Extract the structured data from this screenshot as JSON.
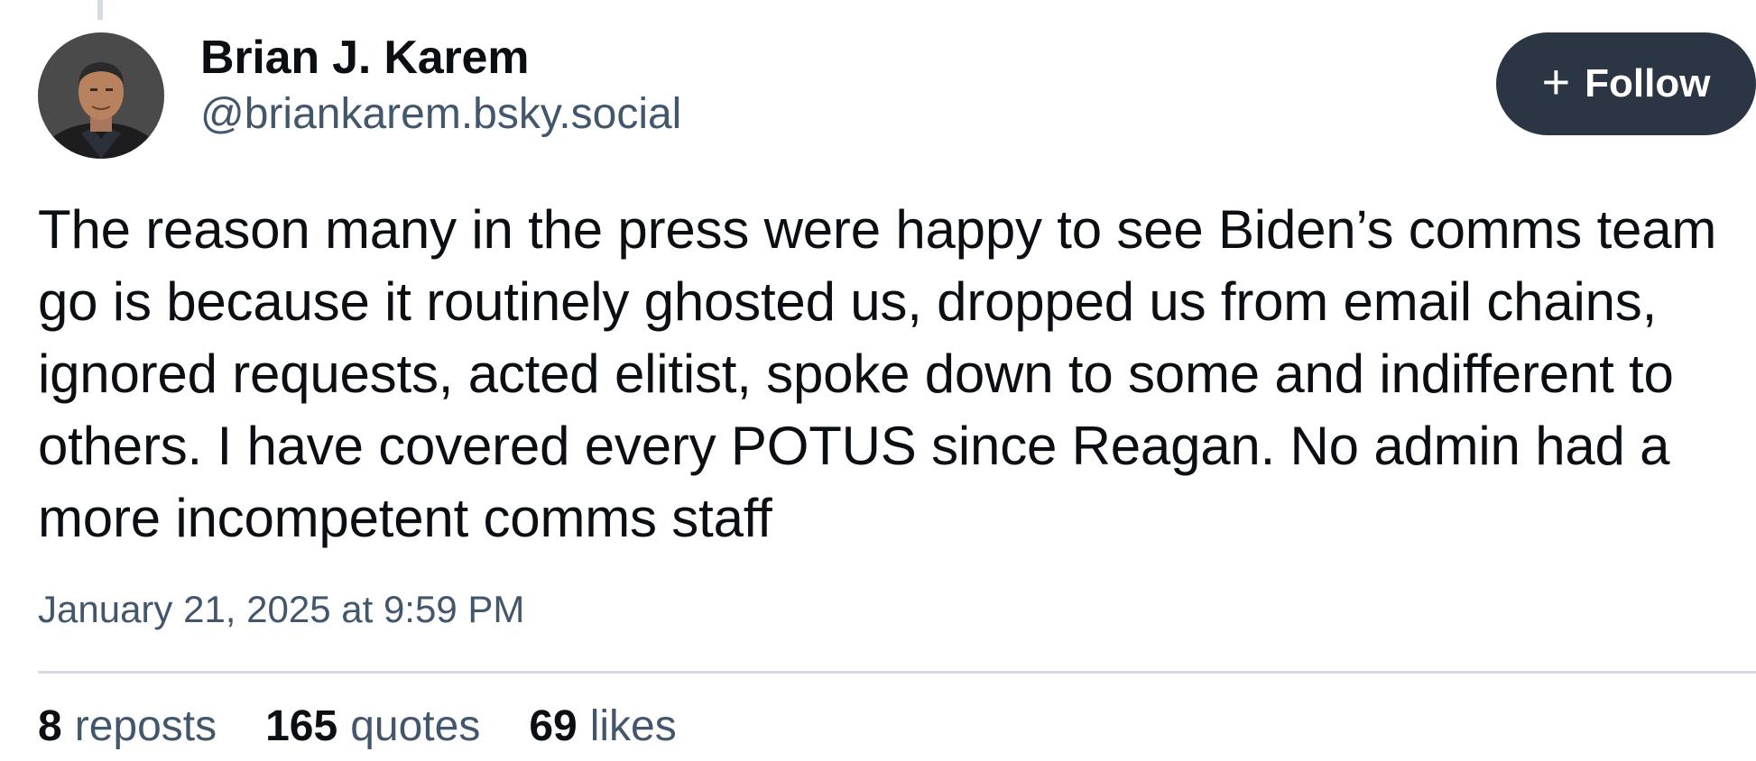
{
  "post": {
    "author": {
      "display_name": "Brian J. Karem",
      "handle": "@briankarem.bsky.social"
    },
    "follow_button": {
      "icon": "plus-icon",
      "label": "Follow"
    },
    "text": "The reason many in the press were happy to see Biden’s comms team go is because it routinely ghosted us, dropped us from email chains, ignored requests, acted elitist, spoke down to some and indifferent to others. I have covered every POTUS since Reagan. No admin had a more incompetent comms staff",
    "timestamp": "January 21, 2025 at 9:59 PM",
    "stats": {
      "reposts": {
        "count": "8",
        "label": "reposts"
      },
      "quotes": {
        "count": "165",
        "label": "quotes"
      },
      "likes": {
        "count": "69",
        "label": "likes"
      }
    }
  },
  "colors": {
    "follow_bg": "#2c3544",
    "secondary_text": "#42576c",
    "divider": "#d4dbe2"
  }
}
